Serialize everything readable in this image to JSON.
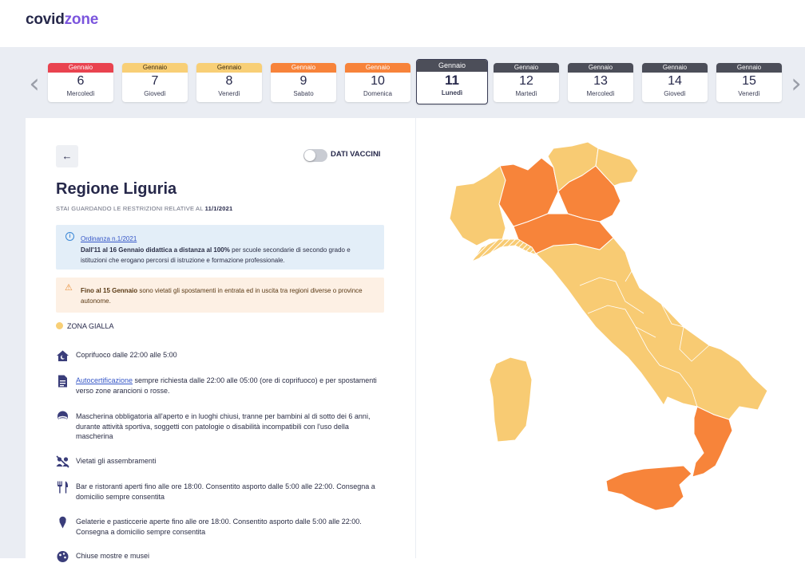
{
  "header": {
    "logo_part1": "covid",
    "logo_part2": "zone"
  },
  "nav": {
    "prev_icon": "chevron-left-icon",
    "next_icon": "chevron-right-icon"
  },
  "dates": [
    {
      "month": "Gennaio",
      "day": "6",
      "weekday": "Mercoledì",
      "zone": "red"
    },
    {
      "month": "Gennaio",
      "day": "7",
      "weekday": "Giovedì",
      "zone": "yellow"
    },
    {
      "month": "Gennaio",
      "day": "8",
      "weekday": "Venerdì",
      "zone": "yellow"
    },
    {
      "month": "Gennaio",
      "day": "9",
      "weekday": "Sabato",
      "zone": "orange"
    },
    {
      "month": "Gennaio",
      "day": "10",
      "weekday": "Domenica",
      "zone": "orange"
    },
    {
      "month": "Gennaio",
      "day": "11",
      "weekday": "Lunedì",
      "zone": "dark",
      "selected": true
    },
    {
      "month": "Gennaio",
      "day": "12",
      "weekday": "Martedì",
      "zone": "dark"
    },
    {
      "month": "Gennaio",
      "day": "13",
      "weekday": "Mercoledì",
      "zone": "dark"
    },
    {
      "month": "Gennaio",
      "day": "14",
      "weekday": "Giovedì",
      "zone": "dark"
    },
    {
      "month": "Gennaio",
      "day": "15",
      "weekday": "Venerdì",
      "zone": "dark"
    }
  ],
  "panel": {
    "back_icon": "arrow-left-icon",
    "toggle_label": "DATI VACCINI",
    "toggle_on": false,
    "title": "Regione Liguria",
    "subtitle_prefix": "STAI GUARDANDO LE RESTRIZIONI RELATIVE AL ",
    "subtitle_date": "11/1/2021",
    "info": {
      "link": "Ordinanza n.1/2021",
      "bold": "Dall'11 al 16 Gennaio didattica a distanza al 100%",
      "text": " per scuole secondarie di secondo grado e istituzioni che erogano percorsi di istruzione e formazione professionale."
    },
    "warning": {
      "bold": "Fino al 15 Gennaio",
      "text": " sono vietati gli spostamenti in entrata ed in uscita tra regioni diverse o province autonome."
    },
    "zone_label": "ZONA GIALLA",
    "rules": [
      {
        "icon": "house-moon-icon",
        "text": "Coprifuoco dalle 22:00 alle 5:00"
      },
      {
        "icon": "document-icon",
        "link": "Autocertificazione",
        "text": " sempre richiesta dalle 22:00 alle 05:00 (ore di coprifuoco) e per spostamenti verso zone arancioni o rosse."
      },
      {
        "icon": "mask-icon",
        "text": "Mascherina obbligatoria all'aperto e in luoghi chiusi, tranne per bambini al di sotto dei 6 anni, durante attività sportiva, soggetti con patologie o disabilità incompatibili con l'uso della mascherina"
      },
      {
        "icon": "no-gathering-icon",
        "text": "Vietati gli assembramenti"
      },
      {
        "icon": "fork-knife-icon",
        "text": "Bar e ristoranti aperti fino alle ore 18:00. Consentito asporto dalle 5:00 alle 22:00. Consegna a domicilio sempre consentita"
      },
      {
        "icon": "ice-cream-icon",
        "text": "Gelaterie e pasticcerie aperte fino alle ore 18:00. Consentito asporto dalle 5:00 alle 22:00. Consegna a domicilio sempre consentita"
      },
      {
        "icon": "museum-icon",
        "text": "Chiuse mostre e musei"
      }
    ]
  },
  "map": {
    "colors": {
      "yellow": "#f8cb73",
      "orange": "#f7843a",
      "border": "#ffffff",
      "accent": "#7b55dd"
    }
  }
}
